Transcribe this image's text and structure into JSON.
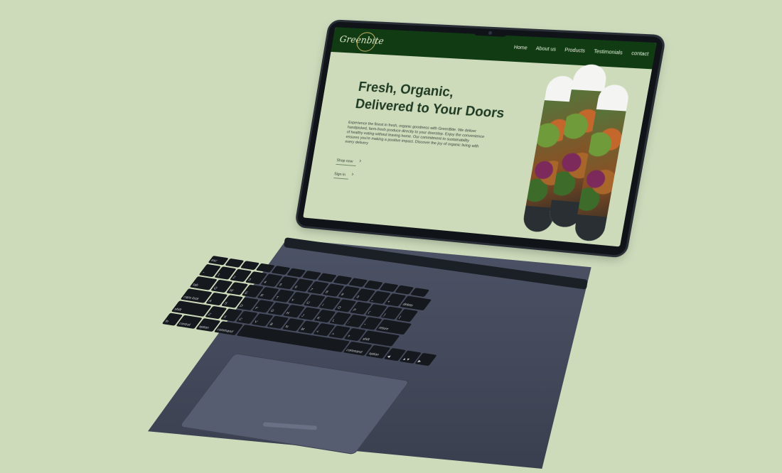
{
  "site": {
    "logo_text": "Greenbite",
    "nav": [
      "Home",
      "About us",
      "Products",
      "Testimonials",
      "contact"
    ]
  },
  "hero": {
    "title_line1": "Fresh, Organic,",
    "title_line2": "Delivered to Your Doors",
    "description": "Experience the finest in fresh, organic goodness with GreenBite. We deliver handpicked, farm-fresh produce directly to your doorstep. Enjoy the convenience of healthy eating without leaving home. Our commitment to sustainability ensures you're making a positive impact. Discover the joy of organic living with every delivery",
    "shop_label": "Shop now",
    "signin_label": "Sign in",
    "arrow_glyph": "›"
  },
  "keyboard": {
    "rows": [
      [
        "esc",
        "",
        "",
        "",
        "",
        "",
        "",
        "",
        "",
        "",
        "",
        "",
        "",
        ""
      ],
      [
        "~",
        "1",
        "2",
        "3",
        "4",
        "5",
        "6",
        "7",
        "8",
        "9",
        "0",
        "_",
        "+",
        "delete"
      ],
      [
        "tab",
        "Q",
        "W",
        "E",
        "R",
        "T",
        "Y",
        "U",
        "I",
        "O",
        "P",
        "{",
        "}",
        "|"
      ],
      [
        "caps lock",
        "A",
        "S",
        "D",
        "F",
        "G",
        "H",
        "J",
        "K",
        "L",
        ":",
        "\"",
        "return"
      ],
      [
        "shift",
        "Z",
        "X",
        "C",
        "V",
        "B",
        "N",
        "M",
        "<",
        ">",
        "?",
        "shift"
      ],
      [
        "fn",
        "control",
        "option",
        "command",
        "",
        "command",
        "option",
        "◀",
        "▲▼",
        "▶"
      ]
    ]
  },
  "colors": {
    "background": "#cddbbb",
    "nav_bg": "#113c13",
    "title": "#1e3a22"
  }
}
